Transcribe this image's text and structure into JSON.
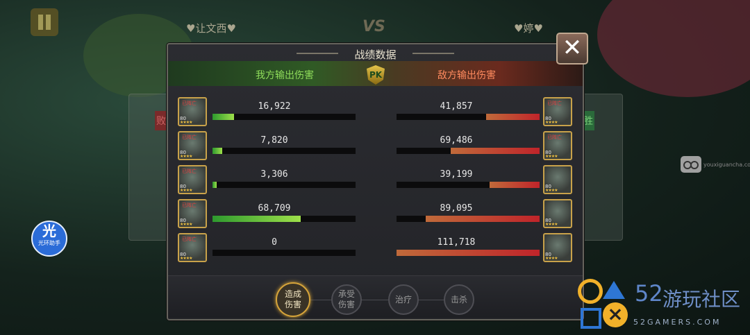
{
  "top": {
    "player_left": "♥让文西♥",
    "vs": "VS",
    "player_right": "♥婷♥",
    "lose_label": "败",
    "win_label": "胜"
  },
  "panel": {
    "title": "战绩数据",
    "our_header": "我方输出伤害",
    "enemy_header": "敌方输出伤害",
    "pk_label": "PK",
    "close_icon": "✕"
  },
  "colors": {
    "our_bar": "#9ee04a",
    "enemy_bar": "#c0242a",
    "active_tab": "#d6a43a"
  },
  "max_damage": 111718,
  "left_rows": [
    {
      "value": "16,922",
      "number": 16922,
      "status": "已阵亡",
      "level": "80",
      "stars": "★★★★"
    },
    {
      "value": "7,820",
      "number": 7820,
      "status": "已阵亡",
      "level": "80",
      "stars": "★★★★"
    },
    {
      "value": "3,306",
      "number": 3306,
      "status": "已阵亡",
      "level": "80",
      "stars": "★★★★"
    },
    {
      "value": "68,709",
      "number": 68709,
      "status": "已阵亡",
      "level": "80",
      "stars": "★★★★"
    },
    {
      "value": "0",
      "number": 0,
      "status": "已阵亡",
      "level": "80",
      "stars": "★★★★"
    }
  ],
  "right_rows": [
    {
      "value": "41,857",
      "number": 41857,
      "status": "已阵亡",
      "level": "80",
      "stars": "★★★★"
    },
    {
      "value": "69,486",
      "number": 69486,
      "status": "已阵亡",
      "level": "80",
      "stars": "★★★★"
    },
    {
      "value": "39,199",
      "number": 39199,
      "status": "",
      "level": "80",
      "stars": "★★★★"
    },
    {
      "value": "89,095",
      "number": 89095,
      "status": "",
      "level": "80",
      "stars": "★★★★"
    },
    {
      "value": "111,718",
      "number": 111718,
      "status": "",
      "level": "80",
      "stars": "★★★★"
    }
  ],
  "tabs": [
    {
      "label": "造成伤害",
      "active": true
    },
    {
      "label": "承受伤害",
      "active": false
    },
    {
      "label": "治疗",
      "active": false
    },
    {
      "label": "击杀",
      "active": false
    }
  ],
  "overlay": {
    "float_text": "youxiguancha.com",
    "helper_big": "光",
    "helper_small": "光环助手",
    "watermark_num": "52",
    "watermark_cn": "游玩社区",
    "watermark_en": "52GAMERS.COM"
  }
}
